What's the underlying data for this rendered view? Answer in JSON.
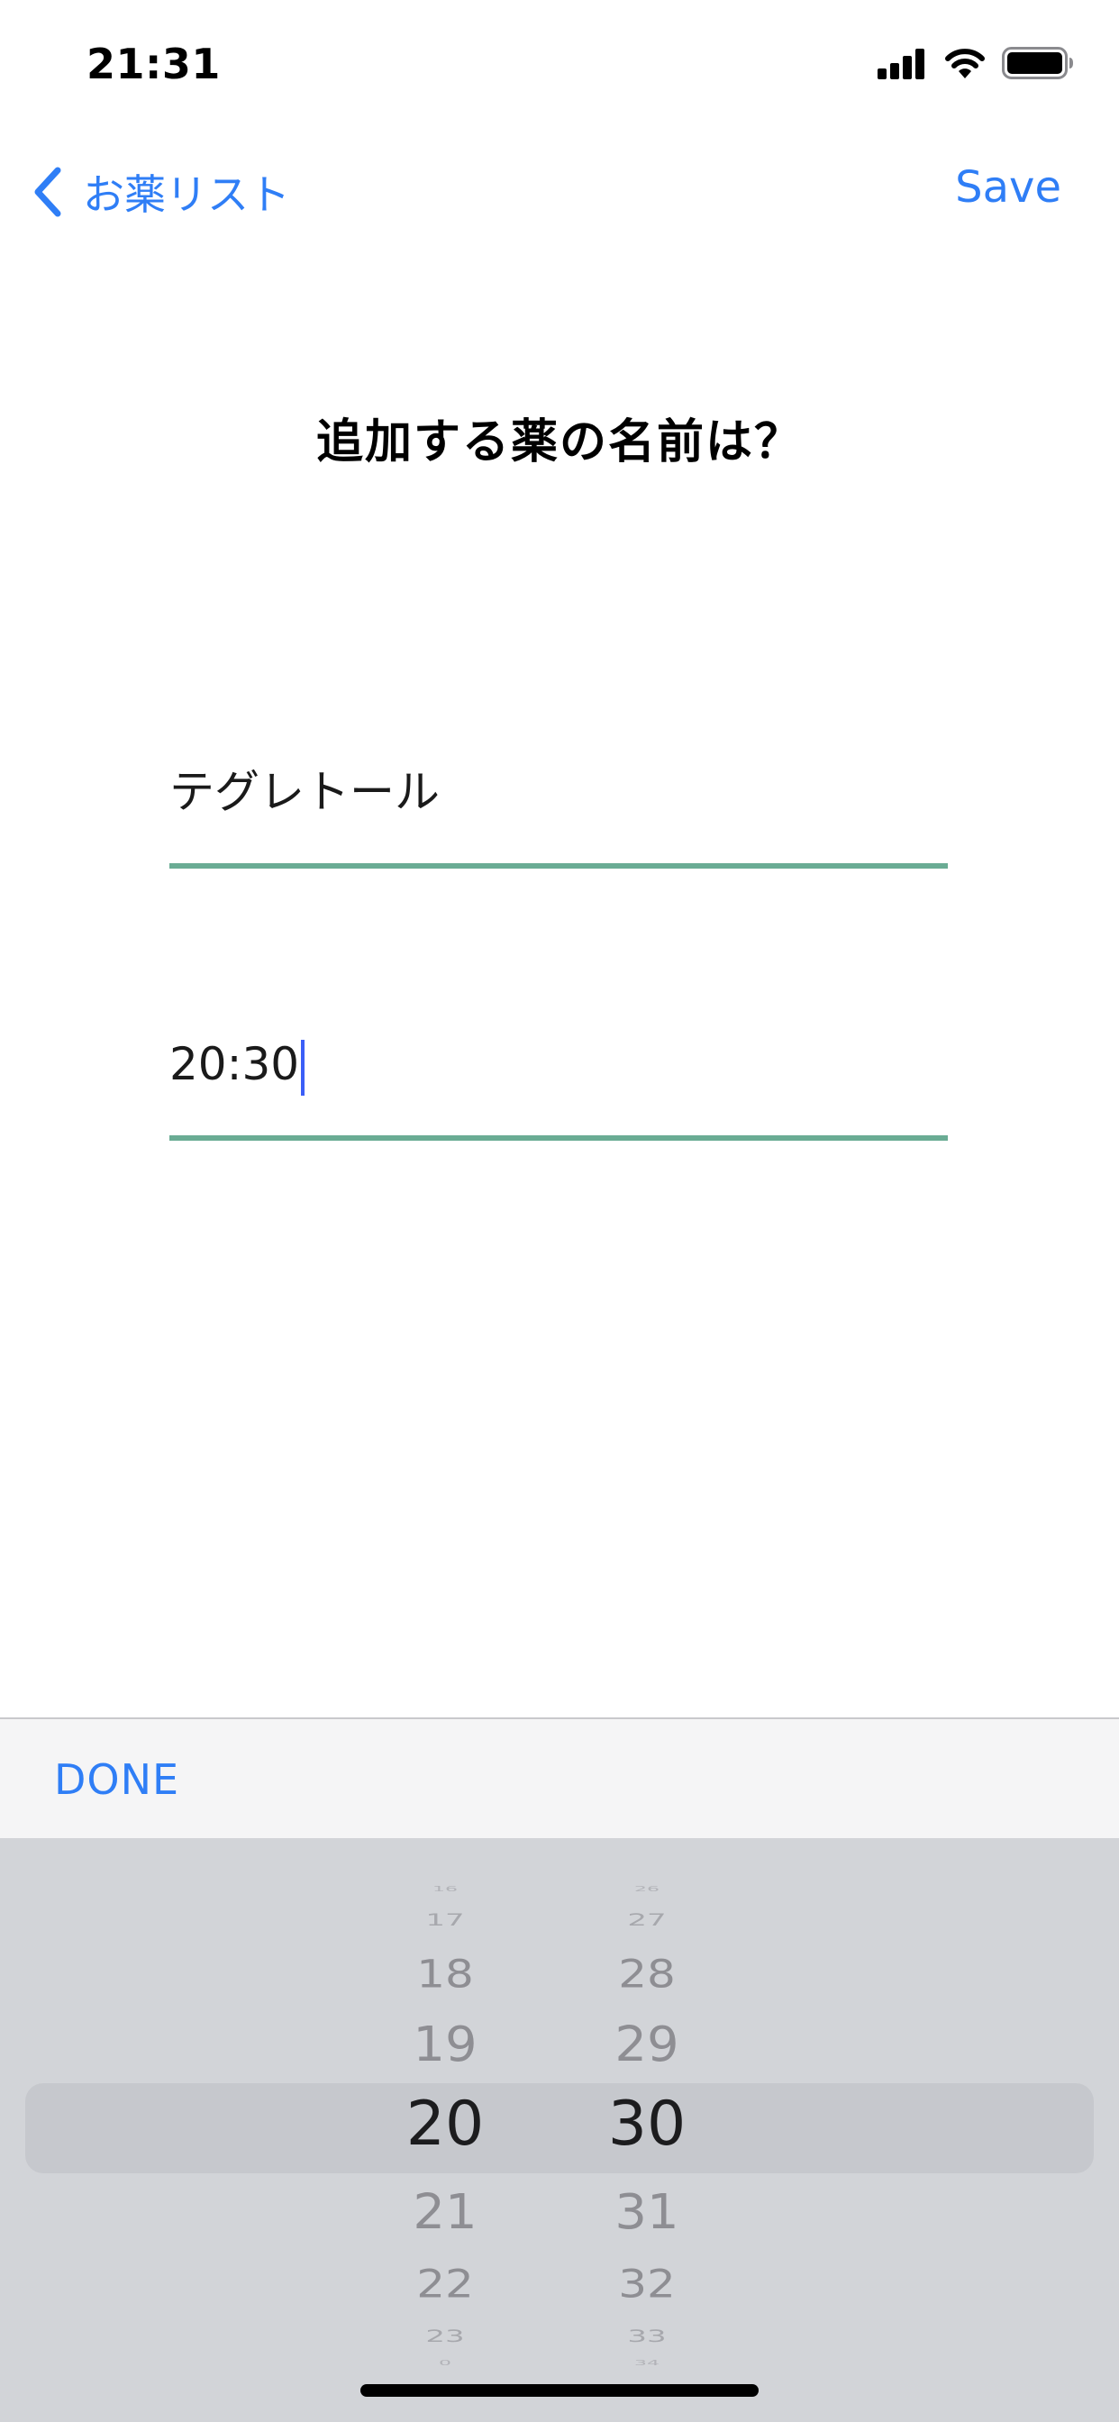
{
  "status_bar": {
    "time": "21:31",
    "icons": [
      "cellular-signal-icon",
      "wifi-icon",
      "battery-icon"
    ]
  },
  "nav": {
    "back_label": "お薬リスト",
    "save_label": "Save"
  },
  "page": {
    "title": "追加する薬の名前は？"
  },
  "form": {
    "medicine_name": "テグレトール",
    "time": "20:30"
  },
  "toolbar": {
    "done_label": "DONE"
  },
  "picker": {
    "hours": [
      "16",
      "17",
      "18",
      "19",
      "20",
      "21",
      "22",
      "23",
      "0"
    ],
    "minutes": [
      "26",
      "27",
      "28",
      "29",
      "30",
      "31",
      "32",
      "33",
      "34"
    ],
    "selected_hour": "20",
    "selected_minute": "30"
  },
  "colors": {
    "accent": "#2f7ef6",
    "underline": "#6aac94",
    "caret": "#3b5ef7",
    "picker_background": "#d2d4d8"
  }
}
